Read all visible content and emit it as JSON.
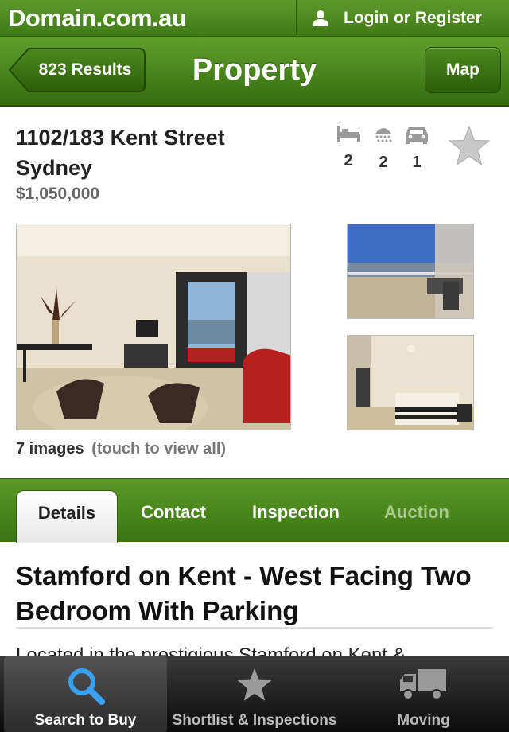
{
  "brand": {
    "logo": "Domain.com.au",
    "login_label": "Login or Register"
  },
  "nav": {
    "back_label": "823 Results",
    "title": "Property",
    "map_label": "Map"
  },
  "listing": {
    "address_line1": "1102/183 Kent Street",
    "address_line2": "Sydney",
    "price": "$1,050,000",
    "features": [
      {
        "icon": "bed-icon",
        "value": "2"
      },
      {
        "icon": "shower-icon",
        "value": "2"
      },
      {
        "icon": "car-icon",
        "value": "1"
      }
    ]
  },
  "photos": {
    "count_label": "7 images",
    "hint": "(touch to view all)"
  },
  "tabs": [
    {
      "label": "Details",
      "state": "active"
    },
    {
      "label": "Contact",
      "state": "normal"
    },
    {
      "label": "Inspection",
      "state": "normal"
    },
    {
      "label": "Auction",
      "state": "disabled"
    }
  ],
  "description": {
    "title": "Stamford on Kent - West Facing Two Bedroom With Parking",
    "text": "Located in the prestigious Stamford on Kent &"
  },
  "bottom_tabs": [
    {
      "label": "Search to Buy",
      "icon": "search-icon",
      "active": true
    },
    {
      "label": "Shortlist & Inspections",
      "icon": "star-icon",
      "active": false
    },
    {
      "label": "Moving",
      "icon": "truck-icon",
      "active": false
    }
  ],
  "colors": {
    "brand_green": "#4a8a1c",
    "tab_dim": "#a8c98d",
    "price_gray": "#666666"
  }
}
